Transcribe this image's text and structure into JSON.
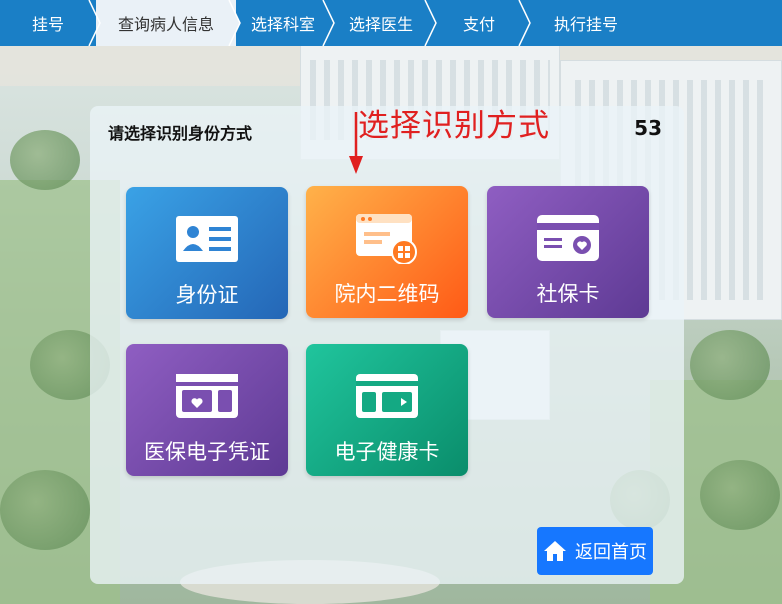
{
  "steps": [
    {
      "label": "挂号"
    },
    {
      "label": "查询病人信息",
      "active": true
    },
    {
      "label": "选择科室"
    },
    {
      "label": "选择医生"
    },
    {
      "label": "支付"
    },
    {
      "label": "执行挂号"
    }
  ],
  "panel": {
    "title": "请选择识别身份方式",
    "countdown": "53"
  },
  "annotation": {
    "text": "选择识别方式",
    "color": "#e02020"
  },
  "options": [
    {
      "label": "身份证",
      "icon": "id-card-icon"
    },
    {
      "label": "院内二维码",
      "icon": "qr-code-window-icon"
    },
    {
      "label": "社保卡",
      "icon": "social-security-card-icon"
    },
    {
      "label": "医保电子凭证",
      "icon": "medical-insurance-card-icon"
    },
    {
      "label": "电子健康卡",
      "icon": "health-card-icon"
    }
  ],
  "home_button": {
    "label": "返回首页",
    "icon": "home-icon"
  },
  "colors": {
    "topbar": "#1a7fc6",
    "home_button": "#1677ff"
  }
}
